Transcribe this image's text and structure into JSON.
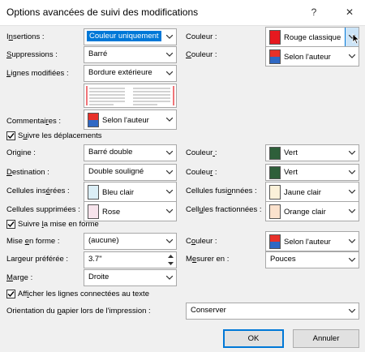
{
  "title": "Options avancées de suivi des modifications",
  "help_label": "?",
  "close_label": "✕",
  "rows": {
    "insertions_label_pre": "I",
    "insertions_label_u": "n",
    "insertions_label_post": "sertions :",
    "insertions_value": "Couleur uniquement",
    "insertions_color_label": "Couleur :",
    "insertions_color_value": "Rouge classique",
    "suppressions_label_u": "S",
    "suppressions_label_post": "uppressions :",
    "suppressions_value": "Barré",
    "suppressions_color_label_pre": "C",
    "suppressions_color_label_u": "o",
    "suppressions_color_label_post": "uleur :",
    "suppressions_color_value": "Selon l'auteur",
    "lignes_label_u": "L",
    "lignes_label_post": "ignes modifiées :",
    "lignes_value": "Bordure extérieure",
    "commentaires_label_pre": "Commentai",
    "commentaires_label_u": "r",
    "commentaires_label_post": "es :",
    "commentaires_value": "Selon l'auteur",
    "suivre_depl_pre": "S",
    "suivre_depl_u": "u",
    "suivre_depl_post": "ivre les déplacements",
    "origine_label_pre": "Ori",
    "origine_label_u": "g",
    "origine_label_post": "ine :",
    "origine_value": "Barré double",
    "origine_color_label_pre": "Couleur",
    "origine_color_label_u": " ",
    "origine_color_label_post": ":",
    "origine_color_value": "Vert",
    "destination_label_u": "D",
    "destination_label_post": "estination :",
    "destination_value": "Double souligné",
    "destination_color_label_pre": "Couleu",
    "destination_color_label_u": "r",
    "destination_color_label_post": " :",
    "destination_color_value": "Vert",
    "cell_ins_label_pre": "Cellules ins",
    "cell_ins_label_u": "é",
    "cell_ins_label_post": "rées :",
    "cell_ins_value": "Bleu clair",
    "cell_fus_label_pre": "Cellules fusi",
    "cell_fus_label_u": "o",
    "cell_fus_label_post": "nnées :",
    "cell_fus_value": "Jaune clair",
    "cell_sup_label_pre": "Cellules supprimées :",
    "cell_sup_value": "Rose",
    "cell_frac_label_pre": "Cell",
    "cell_frac_label_u": "u",
    "cell_frac_label_post": "les fractionnées :",
    "cell_frac_value": "Orange clair",
    "suivre_mise_pre": "Suivre ",
    "suivre_mise_u": "l",
    "suivre_mise_post": "a mise en forme",
    "mise_label_pre": "Mise ",
    "mise_label_u": "e",
    "mise_label_post": "n forme :",
    "mise_value": "(aucune)",
    "mise_color_label_pre": "C",
    "mise_color_label_u": "o",
    "mise_color_label_post": "uleur :",
    "mise_color_value": "Selon l'auteur",
    "largeur_label": "Largeur préférée :",
    "largeur_value": "3.7\"",
    "mesurer_label_pre": "M",
    "mesurer_label_u": "e",
    "mesurer_label_post": "surer en :",
    "mesurer_value": "Pouces",
    "marge_label_u": "M",
    "marge_label_post": "arge :",
    "marge_value": "Droite",
    "afficher_pre": "Aff",
    "afficher_u": "i",
    "afficher_post": "cher les lignes connectées au texte",
    "orientation_label_pre": "Orientation du ",
    "orientation_label_u": "p",
    "orientation_label_post": "apier lors de l'impression :",
    "orientation_value": "Conserver"
  },
  "buttons": {
    "ok": "OK",
    "cancel": "Annuler"
  },
  "colors": {
    "rouge": "#e6191f",
    "vert": "#2e5f3a",
    "bleu_clair": "#dbeef6",
    "jaune_clair": "#fbf1d9",
    "rose": "#f7e4ec",
    "orange_clair": "#fbe2cd",
    "accent": "#0078d7"
  },
  "icons": [
    "help-icon",
    "close-icon",
    "chevron-down-icon",
    "checkmark-icon",
    "mouse-cursor-icon",
    "spin-up-icon",
    "spin-down-icon"
  ]
}
